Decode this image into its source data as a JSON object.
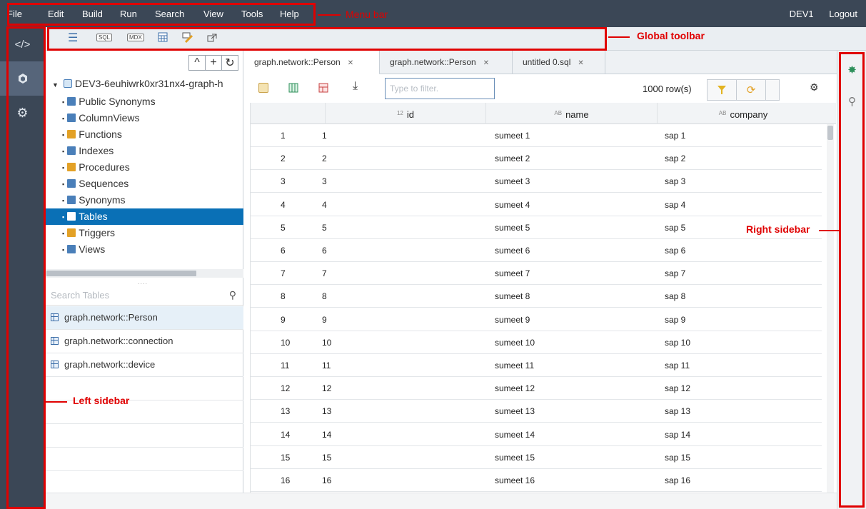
{
  "menubar": {
    "items": [
      "File",
      "Edit",
      "Build",
      "Run",
      "Search",
      "View",
      "Tools",
      "Help"
    ],
    "user": "DEV1",
    "logout": "Logout"
  },
  "strip": {
    "items": [
      {
        "icon": "code-icon",
        "glyph": "</>"
      },
      {
        "icon": "database-explorer-icon",
        "glyph": "⬢"
      },
      {
        "icon": "gear-icon",
        "glyph": "⚙"
      }
    ]
  },
  "toolbar": {
    "icons": [
      "hamburger-menu-icon",
      "sql-console-icon",
      "mdx-console-icon",
      "calculator-icon",
      "sql-edit-icon",
      "export-icon"
    ],
    "sql_label": "SQL",
    "mdx_label": "MDX"
  },
  "nav": {
    "actions": [
      "^",
      "+",
      "↻"
    ],
    "root": "DEV3-6euhiwrk0xr31nx4-graph-h",
    "items": [
      {
        "label": "Public Synonyms",
        "color": "#4a7fb9"
      },
      {
        "label": "ColumnViews",
        "color": "#4a7fb9"
      },
      {
        "label": "Functions",
        "color": "#e3a126"
      },
      {
        "label": "Indexes",
        "color": "#4a7fb9"
      },
      {
        "label": "Procedures",
        "color": "#e3a126"
      },
      {
        "label": "Sequences",
        "color": "#4a7fb9"
      },
      {
        "label": "Synonyms",
        "color": "#4a7fb9"
      },
      {
        "label": "Tables",
        "color": "#4a7fb9"
      },
      {
        "label": "Triggers",
        "color": "#e3a126"
      },
      {
        "label": "Views",
        "color": "#4a7fb9"
      }
    ],
    "selected_index": 7,
    "search_placeholder": "Search Tables",
    "tables": [
      "graph.network::Person",
      "graph.network::connection",
      "graph.network::device"
    ]
  },
  "editor": {
    "tabs": [
      {
        "label": "graph.network::Person"
      },
      {
        "label": "graph.network::Person"
      },
      {
        "label": "untitled 0.sql"
      }
    ],
    "active_tab": 0,
    "filter_placeholder": "Type to filter.",
    "row_count": "1000 row(s)",
    "columns": [
      {
        "type": "12",
        "name": "id"
      },
      {
        "type": "AB",
        "name": "name"
      },
      {
        "type": "AB",
        "name": "company"
      }
    ],
    "rows": [
      [
        "1",
        "1",
        "sumeet 1",
        "sap 1"
      ],
      [
        "2",
        "2",
        "sumeet 2",
        "sap 2"
      ],
      [
        "3",
        "3",
        "sumeet 3",
        "sap 3"
      ],
      [
        "4",
        "4",
        "sumeet 4",
        "sap 4"
      ],
      [
        "5",
        "5",
        "sumeet 5",
        "sap 5"
      ],
      [
        "6",
        "6",
        "sumeet 6",
        "sap 6"
      ],
      [
        "7",
        "7",
        "sumeet 7",
        "sap 7"
      ],
      [
        "8",
        "8",
        "sumeet 8",
        "sap 8"
      ],
      [
        "9",
        "9",
        "sumeet 9",
        "sap 9"
      ],
      [
        "10",
        "10",
        "sumeet 10",
        "sap 10"
      ],
      [
        "11",
        "11",
        "sumeet 11",
        "sap 11"
      ],
      [
        "12",
        "12",
        "sumeet 12",
        "sap 12"
      ],
      [
        "13",
        "13",
        "sumeet 13",
        "sap 13"
      ],
      [
        "14",
        "14",
        "sumeet 14",
        "sap 14"
      ],
      [
        "15",
        "15",
        "sumeet 15",
        "sap 15"
      ],
      [
        "16",
        "16",
        "sumeet 16",
        "sap 16"
      ]
    ]
  },
  "rightbar": {
    "icons": [
      "bug-icon",
      "search-icon"
    ]
  },
  "annotations": {
    "menu_bar": "Menu bar",
    "global_toolbar": "Global toolbar",
    "left_sidebar": "Left sidebar",
    "right_sidebar": "Right sidebar",
    "color": "#e00000"
  }
}
